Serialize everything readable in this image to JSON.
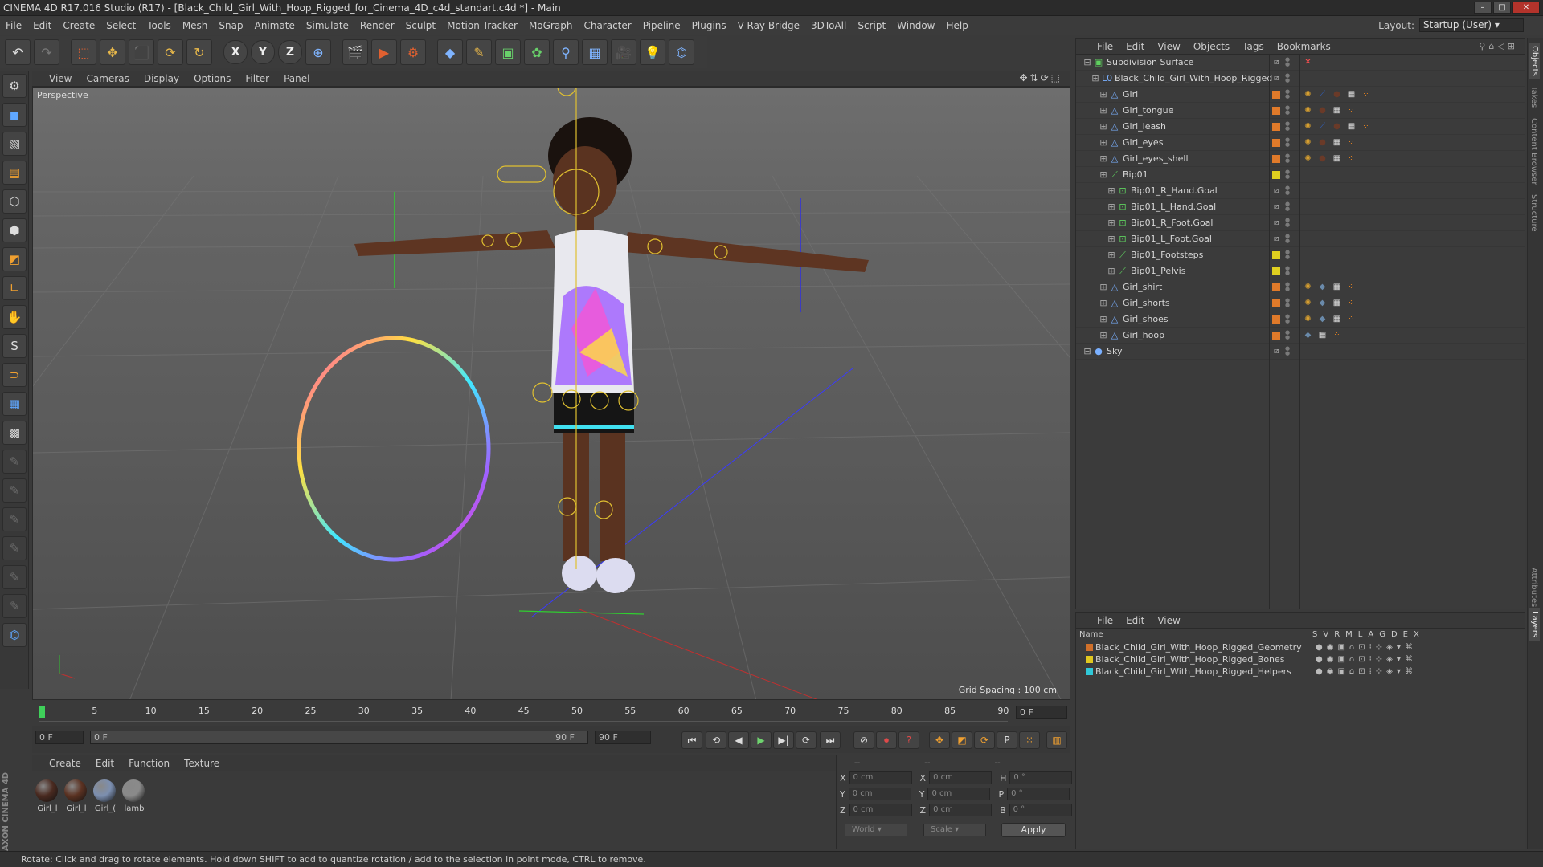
{
  "window": {
    "title": "CINEMA 4D R17.016 Studio (R17) - [Black_Child_Girl_With_Hoop_Rigged_for_Cinema_4D_c4d_standart.c4d *] - Main"
  },
  "menubar": {
    "items": [
      "File",
      "Edit",
      "Create",
      "Select",
      "Tools",
      "Mesh",
      "Snap",
      "Animate",
      "Simulate",
      "Render",
      "Sculpt",
      "Motion Tracker",
      "MoGraph",
      "Character",
      "Pipeline",
      "Plugins",
      "V-Ray Bridge",
      "3DToAll",
      "Script",
      "Window",
      "Help"
    ],
    "layout_label": "Layout:",
    "layout_value": "Startup (User)"
  },
  "toolbar": {
    "x_label": "X",
    "y_label": "Y",
    "z_label": "Z"
  },
  "viewport": {
    "menu": [
      "View",
      "Cameras",
      "Display",
      "Options",
      "Filter",
      "Panel"
    ],
    "label": "Perspective",
    "grid_spacing": "Grid Spacing : 100 cm"
  },
  "timeline": {
    "ticks": [
      "0",
      "5",
      "10",
      "15",
      "20",
      "25",
      "30",
      "35",
      "40",
      "45",
      "50",
      "55",
      "60",
      "65",
      "70",
      "75",
      "80",
      "85",
      "90"
    ],
    "current_frame": "0 F"
  },
  "playback": {
    "start_field": "0 F",
    "range_start": "0 F",
    "range_end": "90 F",
    "end_field": "90 F"
  },
  "materials": {
    "menu": [
      "Create",
      "Edit",
      "Function",
      "Texture"
    ],
    "items": [
      {
        "label": "Girl_l",
        "color": "#4a2a20"
      },
      {
        "label": "Girl_l",
        "color": "#5b3222"
      },
      {
        "label": "Girl_(",
        "color": "#7c8fb0"
      },
      {
        "label": "lamb",
        "color": "#8a8a8a"
      }
    ]
  },
  "coordinates": {
    "header": [
      "--",
      "--",
      "--"
    ],
    "rows": [
      {
        "a": "X",
        "av": "0 cm",
        "b": "X",
        "bv": "0 cm",
        "c": "H",
        "cv": "0 °"
      },
      {
        "a": "Y",
        "av": "0 cm",
        "b": "Y",
        "bv": "0 cm",
        "c": "P",
        "cv": "0 °"
      },
      {
        "a": "Z",
        "av": "0 cm",
        "b": "Z",
        "bv": "0 cm",
        "c": "B",
        "cv": "0 °"
      }
    ],
    "mode1": "World",
    "mode2": "Scale",
    "apply_label": "Apply"
  },
  "status": {
    "text": "Rotate: Click and drag to rotate elements. Hold down SHIFT to add to quantize rotation / add to the selection in point mode, CTRL to remove."
  },
  "objects": {
    "menu": [
      "File",
      "Edit",
      "View",
      "Objects",
      "Tags",
      "Bookmarks"
    ],
    "rows": [
      {
        "name": "Subdivision Surface",
        "depth": 0,
        "icon": "subdivision-icon",
        "swatch": "",
        "tags": [
          "x"
        ]
      },
      {
        "name": "Black_Child_Girl_With_Hoop_Rigged",
        "depth": 1,
        "icon": "null-icon",
        "swatch": "",
        "tags": []
      },
      {
        "name": "Girl",
        "depth": 2,
        "icon": "mesh-icon",
        "swatch": "#e07a2a",
        "tags": [
          "w",
          "b",
          "m",
          "c",
          "p"
        ]
      },
      {
        "name": "Girl_tongue",
        "depth": 2,
        "icon": "mesh-icon",
        "swatch": "#e07a2a",
        "tags": [
          "w",
          "m",
          "c",
          "p"
        ]
      },
      {
        "name": "Girl_leash",
        "depth": 2,
        "icon": "mesh-icon",
        "swatch": "#e07a2a",
        "tags": [
          "w",
          "b",
          "m",
          "c",
          "p"
        ]
      },
      {
        "name": "Girl_eyes",
        "depth": 2,
        "icon": "mesh-icon",
        "swatch": "#e07a2a",
        "tags": [
          "w",
          "m",
          "c",
          "p"
        ]
      },
      {
        "name": "Girl_eyes_shell",
        "depth": 2,
        "icon": "mesh-icon",
        "swatch": "#e07a2a",
        "tags": [
          "w",
          "m",
          "c",
          "p"
        ]
      },
      {
        "name": "Bip01",
        "depth": 2,
        "icon": "bone-icon",
        "swatch": "#e0d020",
        "tags": []
      },
      {
        "name": "Bip01_R_Hand.Goal",
        "depth": 3,
        "icon": "goal-icon",
        "swatch": "",
        "tags": []
      },
      {
        "name": "Bip01_L_Hand.Goal",
        "depth": 3,
        "icon": "goal-icon",
        "swatch": "",
        "tags": []
      },
      {
        "name": "Bip01_R_Foot.Goal",
        "depth": 3,
        "icon": "goal-icon",
        "swatch": "",
        "tags": []
      },
      {
        "name": "Bip01_L_Foot.Goal",
        "depth": 3,
        "icon": "goal-icon",
        "swatch": "",
        "tags": []
      },
      {
        "name": "Bip01_Footsteps",
        "depth": 3,
        "icon": "bone-icon",
        "swatch": "#e0d020",
        "tags": []
      },
      {
        "name": "Bip01_Pelvis",
        "depth": 3,
        "icon": "bone-icon",
        "swatch": "#e0d020",
        "tags": []
      },
      {
        "name": "Girl_shirt",
        "depth": 2,
        "icon": "mesh-icon",
        "swatch": "#e07a2a",
        "tags": [
          "w",
          "s",
          "c",
          "p"
        ]
      },
      {
        "name": "Girl_shorts",
        "depth": 2,
        "icon": "mesh-icon",
        "swatch": "#e07a2a",
        "tags": [
          "w",
          "s",
          "c",
          "p"
        ]
      },
      {
        "name": "Girl_shoes",
        "depth": 2,
        "icon": "mesh-icon",
        "swatch": "#e07a2a",
        "tags": [
          "w",
          "s",
          "c",
          "p"
        ]
      },
      {
        "name": "Girl_hoop",
        "depth": 2,
        "icon": "mesh-icon",
        "swatch": "#e07a2a",
        "tags": [
          "s",
          "c",
          "p"
        ]
      },
      {
        "name": "Sky",
        "depth": 0,
        "icon": "sky-icon",
        "swatch": "",
        "tags": []
      }
    ]
  },
  "layers": {
    "menu": [
      "File",
      "Edit",
      "View"
    ],
    "name_header": "Name",
    "columns": [
      "S",
      "V",
      "R",
      "M",
      "L",
      "A",
      "G",
      "D",
      "E",
      "X"
    ],
    "rows": [
      {
        "name": "Black_Child_Girl_With_Hoop_Rigged_Geometry",
        "color": "#d0702a"
      },
      {
        "name": "Black_Child_Girl_With_Hoop_Rigged_Bones",
        "color": "#e0c820"
      },
      {
        "name": "Black_Child_Girl_With_Hoop_Rigged_Helpers",
        "color": "#30c8d8"
      }
    ]
  },
  "side_tabs": [
    "Objects",
    "Takes",
    "Content Browser",
    "Structure",
    "Attributes",
    "Layers"
  ]
}
